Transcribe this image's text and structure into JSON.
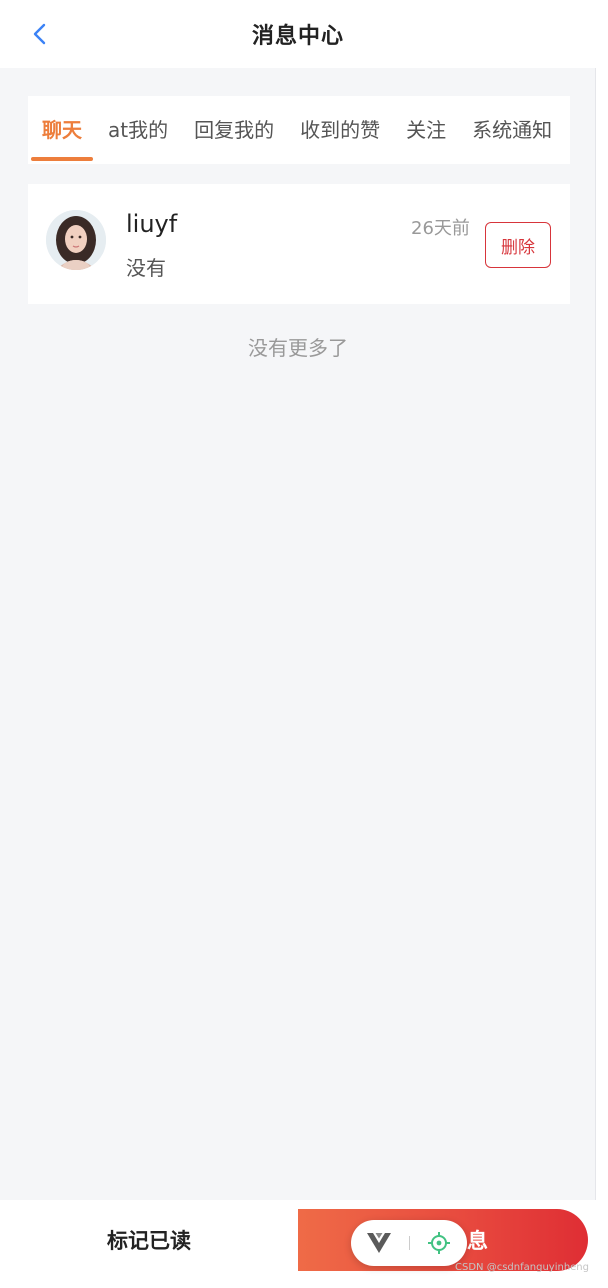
{
  "header": {
    "title": "消息中心",
    "back_icon": "chevron-left-icon"
  },
  "tabs": [
    {
      "label": "聊天",
      "active": true
    },
    {
      "label": "at我的",
      "active": false
    },
    {
      "label": "回复我的",
      "active": false
    },
    {
      "label": "收到的赞",
      "active": false
    },
    {
      "label": "关注",
      "active": false
    },
    {
      "label": "系统通知",
      "active": false
    }
  ],
  "messages": [
    {
      "name": "liuyf",
      "text": "没有",
      "time": "26天前",
      "delete_label": "删除"
    }
  ],
  "list_footer": "没有更多了",
  "bottom": {
    "mark_read_label": "标记已读",
    "action_label": "息"
  },
  "watermark": "CSDN @csdnfanguyinheng",
  "colors": {
    "accent": "#ed7e3c",
    "danger": "#d7353b",
    "gradient_start": "#ef6b47",
    "gradient_end": "#df2e34"
  }
}
